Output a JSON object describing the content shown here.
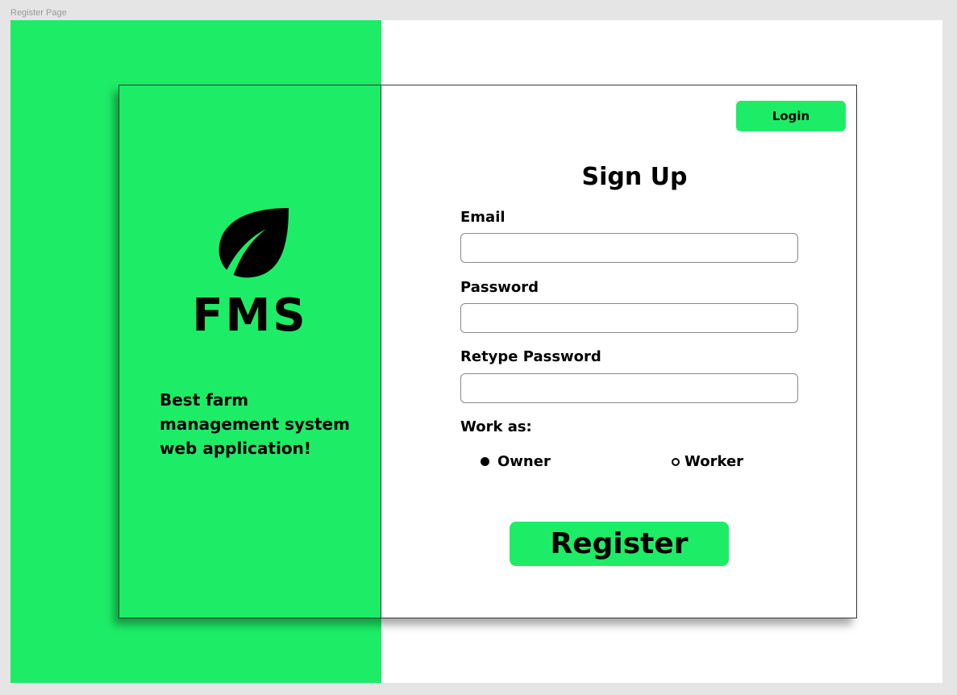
{
  "frame": {
    "label": "Register Page"
  },
  "colors": {
    "accent_green": "#1ded66",
    "border": "#3a3a3a",
    "text": "#000000"
  },
  "brand": {
    "logo_icon": "leaf-icon",
    "name": "FMS",
    "tagline": "Best farm management system web application!"
  },
  "header": {
    "login_label": "Login"
  },
  "form": {
    "title": "Sign Up",
    "email_label": "Email",
    "email_value": "",
    "password_label": "Password",
    "password_value": "",
    "retype_label": "Retype Password",
    "retype_value": "",
    "work_as_label": "Work as:",
    "roles": [
      {
        "label": "Owner",
        "selected": true
      },
      {
        "label": "Worker",
        "selected": false
      }
    ],
    "register_label": "Register"
  }
}
